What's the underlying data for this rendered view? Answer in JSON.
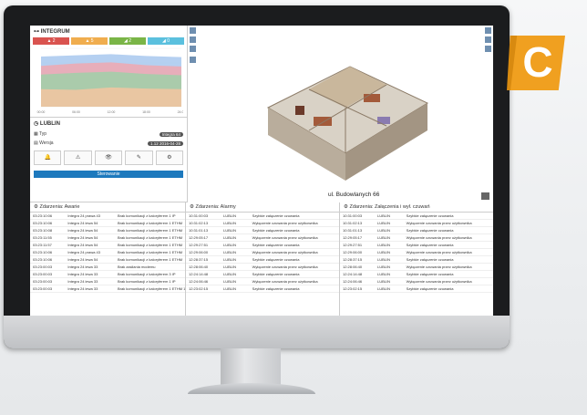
{
  "badge": {
    "letter": "C",
    "color": "#f0a020"
  },
  "integrum": {
    "title": "INTEGRUM",
    "tiles": [
      {
        "label": "▲ 2",
        "color": "#d9534f"
      },
      {
        "label": "▲ 5",
        "color": "#f0ad4e"
      },
      {
        "label": "◢ 2",
        "color": "#7ab547"
      },
      {
        "label": "◢ 0",
        "color": "#5bc0de"
      }
    ],
    "chart_data": {
      "type": "area",
      "x": [
        "00:00",
        "06:00",
        "12:00",
        "18:00",
        "24:00"
      ],
      "series": [
        {
          "values": [
            30,
            29,
            33,
            31,
            30
          ],
          "color": "#f4c6a0"
        },
        {
          "values": [
            55,
            58,
            60,
            56,
            54
          ],
          "color": "#9fd0a8"
        },
        {
          "values": [
            70,
            74,
            76,
            71,
            69
          ],
          "color": "#f0a8b0"
        },
        {
          "values": [
            86,
            88,
            90,
            87,
            85
          ],
          "color": "#a8c8ef"
        }
      ]
    }
  },
  "lublin": {
    "title": "LUBLIN",
    "rows": [
      {
        "label": "Typ",
        "value": "Integra 64"
      },
      {
        "label": "Wersja",
        "value": "1.12 2016-04-28"
      }
    ],
    "action_button": "Sterowanie"
  },
  "map": {
    "address": "ul. Budowlanych 66"
  },
  "tables": [
    {
      "title": "Zdarzenia: Awarie",
      "rows": [
        [
          "03:23:10:06",
          "Integra 24 prawa 43",
          "Brak komunikacji z kaloryferem 1 IP"
        ],
        [
          "03:23:10:06",
          "Integra 24 lewa 54",
          "Brak komunikacji z kaloryferem 1 ETHM"
        ],
        [
          "03:23:10:08",
          "Integra 24 lewa 54",
          "Brak komunikacji z kaloryferem 1 ETHM"
        ],
        [
          "03:23:11:55",
          "Integra 24 lewa 54",
          "Brak komunikacji z kaloryferem 1 ETHM"
        ],
        [
          "03:23:11:57",
          "Integra 24 lewa 54",
          "Brak komunikacji z kaloryferem 1 ETHM"
        ],
        [
          "03:23:10:06",
          "Integra 24 prawa 43",
          "Brak komunikacji z kaloryferem 1 ETHM"
        ],
        [
          "03:23:10:06",
          "Integra 24 lewa 54",
          "Brak komunikacji z kaloryferem 1 ETHM"
        ],
        [
          "03:23:00:03",
          "Integra 24 lewa 33",
          "Brak zasilania modemu"
        ],
        [
          "03:23:00:03",
          "Integra 24 lewa 33",
          "Brak komunikacji z kaloryferem 3 IP"
        ],
        [
          "03:23:00:03",
          "Integra 24 lewa 33",
          "Brak komunikacji z kaloryferem 1 IP"
        ],
        [
          "03:23:00:03",
          "Integra 24 lewa 33",
          "Brak komunikacji z kaloryferem 1 ETHM 1.IG"
        ]
      ]
    },
    {
      "title": "Zdarzenia: Alarmy",
      "rows": [
        [
          "10:31:00:03",
          "LUBLIN",
          "Szybkie załączenie czuwania"
        ],
        [
          "10:31:02:13",
          "LUBLIN",
          "Wyłączenie czuwania przez użytkownika"
        ],
        [
          "10:31:01:13",
          "LUBLIN",
          "Szybkie załączenie czuwania"
        ],
        [
          "12:29:05:17",
          "LUBLIN",
          "Wyłączenie czuwania przez użytkownika"
        ],
        [
          "12:29:27:51",
          "LUBLIN",
          "Szybkie załączenie czuwania"
        ],
        [
          "12:29:06:00",
          "LUBLIN",
          "Wyłączenie czuwania przez użytkownika"
        ],
        [
          "12:28:37:15",
          "LUBLIN",
          "Szybkie załączenie czuwania"
        ],
        [
          "12:28:06:40",
          "LUBLIN",
          "Wyłączenie czuwania przez użytkownika"
        ],
        [
          "12:24:14:48",
          "LUBLIN",
          "Szybkie załączenie czuwania"
        ],
        [
          "12:24:06:46",
          "LUBLIN",
          "Wyłączenie czuwania przez użytkownika"
        ],
        [
          "12:23:02:15",
          "LUBLIN",
          "Szybkie załączenie czuwania"
        ]
      ]
    },
    {
      "title": "Zdarzenia: Załączenia i wył. czuwań",
      "rows": [
        [
          "10:31:00:03",
          "LUBLIN",
          "Szybkie załączenie czuwania"
        ],
        [
          "10:31:02:13",
          "LUBLIN",
          "Wyłączenie czuwania przez użytkownika"
        ],
        [
          "10:31:01:13",
          "LUBLIN",
          "Szybkie załączenie czuwania"
        ],
        [
          "12:29:05:17",
          "LUBLIN",
          "Wyłączenie czuwania przez użytkownika"
        ],
        [
          "12:29:27:51",
          "LUBLIN",
          "Szybkie załączenie czuwania"
        ],
        [
          "12:29:06:00",
          "LUBLIN",
          "Wyłączenie czuwania przez użytkownika"
        ],
        [
          "12:28:37:15",
          "LUBLIN",
          "Szybkie załączenie czuwania"
        ],
        [
          "12:28:06:40",
          "LUBLIN",
          "Wyłączenie czuwania przez użytkownika"
        ],
        [
          "12:24:14:48",
          "LUBLIN",
          "Szybkie załączenie czuwania"
        ],
        [
          "12:24:06:46",
          "LUBLIN",
          "Wyłączenie czuwania przez użytkownika"
        ],
        [
          "12:23:02:15",
          "LUBLIN",
          "Szybkie załączenie czuwania"
        ]
      ]
    }
  ]
}
